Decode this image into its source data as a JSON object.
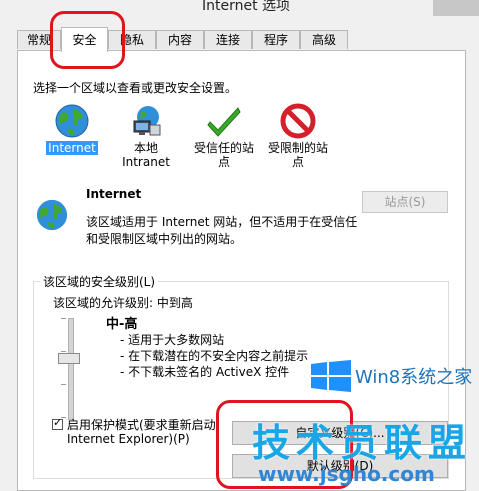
{
  "window": {
    "title": "Internet 选项"
  },
  "tabs": [
    {
      "label": "常规"
    },
    {
      "label": "安全"
    },
    {
      "label": "隐私"
    },
    {
      "label": "内容"
    },
    {
      "label": "连接"
    },
    {
      "label": "程序"
    },
    {
      "label": "高级"
    }
  ],
  "security": {
    "instruction": "选择一个区域以查看或更改安全设置。",
    "zones": [
      {
        "name": "Internet",
        "icon": "globe-icon"
      },
      {
        "name": "本地 Intranet",
        "line1": "本地",
        "line2": "Intranet",
        "icon": "intranet-icon"
      },
      {
        "name": "受信任的站点",
        "line1": "受信任的站",
        "line2": "点",
        "icon": "check-icon"
      },
      {
        "name": "受限制的站点",
        "line1": "受限制的站",
        "line2": "点",
        "icon": "restricted-icon"
      }
    ],
    "selected_zone": {
      "title": "Internet",
      "desc_line1": "该区域适用于 Internet 网站，但不适用于在受信任",
      "desc_line2": "和受限制区域中列出的网站。"
    },
    "sites_button": "站点(S)",
    "level_group_label": "该区域的安全级别(L)",
    "allowed_levels": "该区域的允许级别: 中到高",
    "level_name": "中-高",
    "level_bullets": [
      "- 适用于大多数网站",
      "- 在下载潜在的不安全内容之前提示",
      "- 不下载未签名的 ActiveX 控件"
    ],
    "slider_level_fraction": 0.6,
    "protected_mode": {
      "checked": true,
      "line1": "启用保护模式(要求重新启动",
      "line2": "Internet Explorer)(P)"
    },
    "custom_level_button": "自定义级别(C)...",
    "default_level_button": "默认级别(D)"
  },
  "watermark": {
    "brand": "Win8系统之家",
    "big": "技术员联盟",
    "url": "www.jsgho.com"
  },
  "colors": {
    "highlight": "#3399ff",
    "annotation": "#e0141e"
  }
}
